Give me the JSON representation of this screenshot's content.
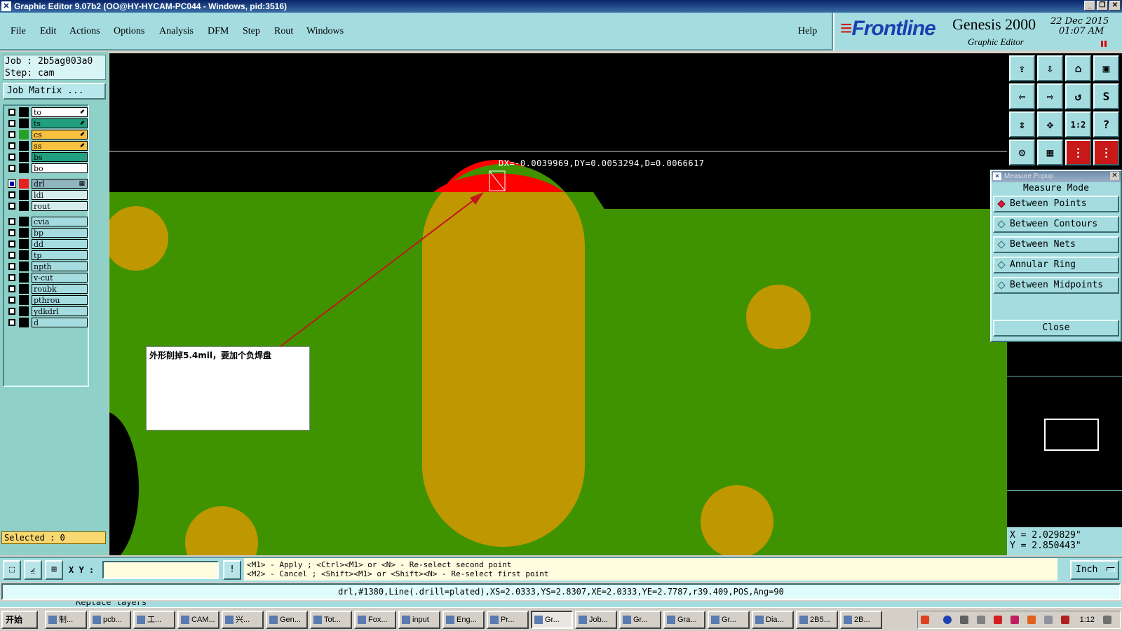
{
  "window": {
    "title": "Graphic Editor 9.07b2 (OO@HY-HYCAM-PC044 - Windows, pid:3516)"
  },
  "menu": {
    "file": "File",
    "edit": "Edit",
    "actions": "Actions",
    "options": "Options",
    "analysis": "Analysis",
    "dfm": "DFM",
    "step": "Step",
    "rout": "Rout",
    "windows": "Windows",
    "help": "Help"
  },
  "banner": {
    "logo": "Frontline",
    "product": "Genesis 2000",
    "subtitle": "Graphic Editor",
    "date": "22 Dec 2015",
    "time": "01:07 AM"
  },
  "job": {
    "job_line": "Job : 2b5ag003a0",
    "step_line": "Step: cam",
    "matrix_button": "Job Matrix ..."
  },
  "layers": [
    {
      "name": "to",
      "color": "#ffffff",
      "swatch": "#000000",
      "arrow": "⬋",
      "active": false
    },
    {
      "name": "ts",
      "color": "#20a080",
      "swatch": "#000000",
      "arrow": "⬋",
      "active": false
    },
    {
      "name": "cs",
      "color": "#f8c040",
      "swatch": "#28a028",
      "arrow": "⬋",
      "active": false
    },
    {
      "name": "ss",
      "color": "#f8c040",
      "swatch": "#000000",
      "arrow": "⬋",
      "active": false
    },
    {
      "name": "bs",
      "color": "#20a080",
      "swatch": "#000000",
      "arrow": "",
      "active": false
    },
    {
      "name": "bo",
      "color": "#ffffff",
      "swatch": "#000000",
      "arrow": "",
      "active": false
    },
    {
      "name": "drl",
      "color": "#90b4c0",
      "swatch": "#e82020",
      "arrow": "▦",
      "active": true
    },
    {
      "name": "ldi",
      "color": "#d4ecec",
      "swatch": "#000000",
      "arrow": "",
      "active": false
    },
    {
      "name": "rout",
      "color": "#d4ecec",
      "swatch": "#000000",
      "arrow": "",
      "active": false
    },
    {
      "name": "cvia",
      "color": "#a4dce0",
      "swatch": "#000000",
      "arrow": "",
      "active": false
    },
    {
      "name": "bp",
      "color": "#a4dce0",
      "swatch": "#000000",
      "arrow": "",
      "active": false
    },
    {
      "name": "dd",
      "color": "#a4dce0",
      "swatch": "#000000",
      "arrow": "",
      "active": false
    },
    {
      "name": "tp",
      "color": "#a4dce0",
      "swatch": "#000000",
      "arrow": "",
      "active": false
    },
    {
      "name": "npth",
      "color": "#a4dce0",
      "swatch": "#000000",
      "arrow": "",
      "active": false
    },
    {
      "name": "v-cut",
      "color": "#a4dce0",
      "swatch": "#000000",
      "arrow": "",
      "active": false
    },
    {
      "name": "roubk",
      "color": "#a4dce0",
      "swatch": "#000000",
      "arrow": "",
      "active": false
    },
    {
      "name": "pthrou",
      "color": "#a4dce0",
      "swatch": "#000000",
      "arrow": "",
      "active": false
    },
    {
      "name": "ydkdrl",
      "color": "#a4dce0",
      "swatch": "#000000",
      "arrow": "",
      "active": false
    },
    {
      "name": "d",
      "color": "#a4dce0",
      "swatch": "#000000",
      "arrow": "",
      "active": false
    }
  ],
  "selected": "Selected : 0",
  "canvas": {
    "measure_readout": "DX=-0.0039969,DY=0.0053294,D=0.0066617",
    "note": "外形削掉5.4mil，要加个负焊盘",
    "colors": {
      "board": "#3f9200",
      "pad": "#bf9700",
      "drill": "#ff0000",
      "background": "#000000"
    }
  },
  "toolbar": [
    {
      "name": "zoom-home-icon",
      "glyph": "⇪",
      "red": false
    },
    {
      "name": "zoom-down-icon",
      "glyph": "⇩",
      "red": false
    },
    {
      "name": "home-icon",
      "glyph": "⌂",
      "red": false
    },
    {
      "name": "window-icon",
      "glyph": "▣",
      "red": false
    },
    {
      "name": "pan-left-icon",
      "glyph": "⇦",
      "red": false
    },
    {
      "name": "pan-right-icon",
      "glyph": "⇨",
      "red": false
    },
    {
      "name": "redraw-icon",
      "glyph": "↺",
      "red": false
    },
    {
      "name": "snap-icon",
      "glyph": "S",
      "red": false
    },
    {
      "name": "fit-vertical-icon",
      "glyph": "⇕",
      "red": false
    },
    {
      "name": "fit-all-icon",
      "glyph": "✥",
      "red": false
    },
    {
      "name": "scale-icon",
      "glyph": "1:2",
      "red": false
    },
    {
      "name": "help-icon",
      "glyph": "?",
      "red": false
    },
    {
      "name": "tools-icon",
      "glyph": "⚙",
      "red": false
    },
    {
      "name": "grid-icon",
      "glyph": "▦",
      "red": false
    },
    {
      "name": "net-icon",
      "glyph": "⋮",
      "red": true
    },
    {
      "name": "layer-icon",
      "glyph": "⋮",
      "red": true
    }
  ],
  "measure_popup": {
    "title": "Measure Popup",
    "header": "Measure Mode",
    "modes": [
      "Between Points",
      "Between Contours",
      "Between Nets",
      "Annular Ring",
      "Between Midpoints"
    ],
    "active_mode": 0,
    "close": "Close"
  },
  "coords": {
    "x": "X = 2.029829\"",
    "y": "Y = 2.850443\""
  },
  "command": {
    "xy_label": "X Y :",
    "hint_line1": "<M1> - Apply  ; <Ctrl><M1> or <N> - Re-select second point",
    "hint_line2": "<M2> - Cancel ; <Shift><M1> or <Shift><N> - Re-select first point",
    "units": "Inch"
  },
  "status": "drl,#1380,Line(.drill=plated),XS=2.0333,YS=2.8307,XE=2.0333,YE=2.7787,r39.409,POS,Ang=90",
  "bottom_strip": "Replace layers",
  "taskbar": {
    "start": "开始",
    "tasks": [
      "制...",
      "pcb...",
      "工...",
      "CAM...",
      "兴...",
      "Gen...",
      "Tot...",
      "Fox...",
      "input",
      "Eng...",
      "Pr...",
      "Gr...",
      "Job...",
      "Gr...",
      "Gra...",
      "Gr...",
      "Dia...",
      "2B5...",
      "2B..."
    ],
    "active_task": 11,
    "clock": "1:12"
  }
}
